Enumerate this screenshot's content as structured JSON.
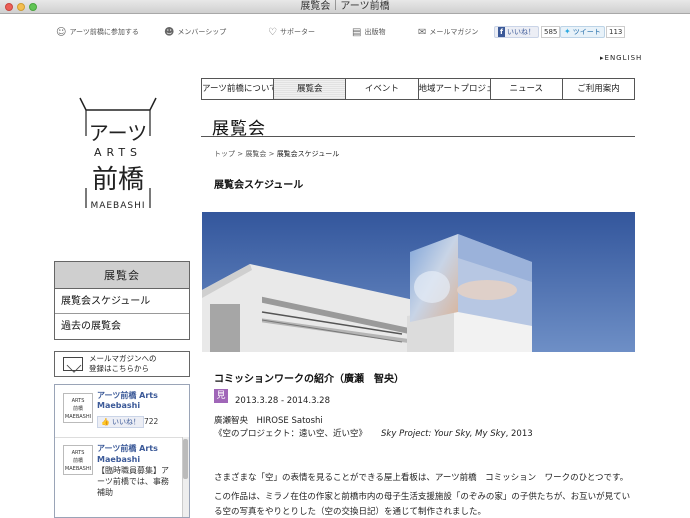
{
  "window": {
    "title": "展覧会｜アーツ前橋"
  },
  "topnav": {
    "join": "アーツ前橋に参加する",
    "membership": "メンバーシップ",
    "supporter": "サポーター",
    "publications": "出版物",
    "newsletter": "メールマガジン",
    "fb_like": "いいね！",
    "fb_count": "585",
    "tweet": "ツイート",
    "tweet_count": "113",
    "english": "ENGLISH"
  },
  "logo": {
    "line1": "アーツ",
    "line2": "ARTS",
    "line3": "前橋",
    "line4": "MAEBASHI"
  },
  "mainnav": [
    "アーツ前橋について",
    "展覧会",
    "イベント",
    "地域アートプロジェクト",
    "ニュース",
    "ご利用案内"
  ],
  "page": {
    "heading": "展覧会",
    "breadcrumb": {
      "home": "トップ",
      "sep": ">",
      "parent": "展覧会",
      "current": "展覧会スケジュール"
    },
    "subheading": "展覧会スケジュール"
  },
  "article": {
    "title": "コミッションワークの紹介（廣瀬　智央）",
    "badge": "見",
    "dates": "2013.3.28 - 2014.3.28",
    "artist": "廣瀬智央　HIROSE Satoshi",
    "project_jp": "《空のプロジェクト：遠い空、近い空》",
    "project_en": "Sky Project: Your Sky, My Sky",
    "project_year": ", 2013",
    "body1": "さまざまな「空」の表情を見ることができる屋上看板は、アーツ前橋　コミッション　ワークのひとつです。",
    "body2": "この作品は、ミラノ在住の作家と前橋市内の母子生活支援施設「のぞみの家」の子供たちが、お互いが見ている空の写真をやりとりした（空の交換日記）を通じて制作されました。"
  },
  "sidebar": {
    "heading": "展覧会",
    "items": [
      "展覧会スケジュール",
      "過去の展覧会"
    ],
    "mail_line1": "メールマガジンへの",
    "mail_line2": "登録はこちらから"
  },
  "fbwidget": {
    "page_name": "アーツ前橋 Arts Maebashi",
    "like_label": "いいね！",
    "like_count": "722",
    "post_name": "アーツ前橋 Arts Maebashi",
    "post_text": "【臨時職員募集】アーツ前橋では、事務補助"
  },
  "colors": {
    "hero_sky": "#3d62a6",
    "badge": "#a066b8",
    "link": "#3b5998"
  }
}
